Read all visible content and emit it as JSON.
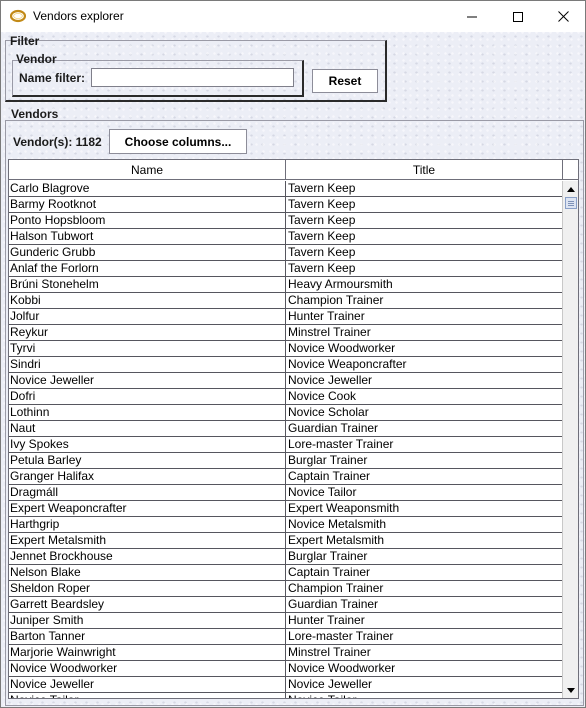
{
  "window": {
    "title": "Vendors explorer",
    "icon": "ring-icon",
    "controls": [
      "minimize-icon",
      "maximize-icon",
      "close-icon"
    ]
  },
  "filter": {
    "group_label": "Filter",
    "vendor_group_label": "Vendor",
    "name_filter_label": "Name filter:",
    "name_filter_value": "",
    "reset_label": "Reset"
  },
  "vendors": {
    "group_label": "Vendors",
    "count_label": "Vendor(s): 1182",
    "choose_columns_label": "Choose columns...",
    "columns": [
      "Name",
      "Title"
    ],
    "rows": [
      [
        "Carlo Blagrove",
        "Tavern Keep"
      ],
      [
        "Barmy Rootknot",
        "Tavern Keep"
      ],
      [
        "Ponto Hopsbloom",
        "Tavern Keep"
      ],
      [
        "Halson Tubwort",
        "Tavern Keep"
      ],
      [
        "Gunderic Grubb",
        "Tavern Keep"
      ],
      [
        "Anlaf the Forlorn",
        "Tavern Keep"
      ],
      [
        "Brúni Stonehelm",
        "Heavy Armoursmith"
      ],
      [
        "Kobbi",
        "Champion Trainer"
      ],
      [
        "Jolfur",
        "Hunter Trainer"
      ],
      [
        "Reykur",
        "Minstrel Trainer"
      ],
      [
        "Tyrvi",
        "Novice Woodworker"
      ],
      [
        "Sindri",
        "Novice Weaponcrafter"
      ],
      [
        "Novice Jeweller",
        "Novice Jeweller"
      ],
      [
        "Dofri",
        "Novice Cook"
      ],
      [
        "Lothinn",
        "Novice Scholar"
      ],
      [
        "Naut",
        "Guardian Trainer"
      ],
      [
        "Ivy Spokes",
        "Lore-master Trainer"
      ],
      [
        "Petula Barley",
        "Burglar Trainer"
      ],
      [
        "Granger Halifax",
        "Captain Trainer"
      ],
      [
        "Dragmáll",
        "Novice Tailor"
      ],
      [
        "Expert Weaponcrafter",
        "Expert Weaponsmith"
      ],
      [
        "Harthgrip",
        "Novice Metalsmith"
      ],
      [
        "Expert Metalsmith",
        "Expert Metalsmith"
      ],
      [
        "Jennet Brockhouse",
        "Burglar Trainer"
      ],
      [
        "Nelson Blake",
        "Captain Trainer"
      ],
      [
        "Sheldon Roper",
        "Champion Trainer"
      ],
      [
        "Garrett Beardsley",
        "Guardian Trainer"
      ],
      [
        "Juniper Smith",
        "Hunter Trainer"
      ],
      [
        "Barton Tanner",
        "Lore-master Trainer"
      ],
      [
        "Marjorie Wainwright",
        "Minstrel Trainer"
      ],
      [
        "Novice Woodworker",
        "Novice Woodworker"
      ],
      [
        "Novice Jeweller",
        "Novice Jeweller"
      ],
      [
        "Novice Tailor",
        "Novice Tailor"
      ]
    ]
  }
}
